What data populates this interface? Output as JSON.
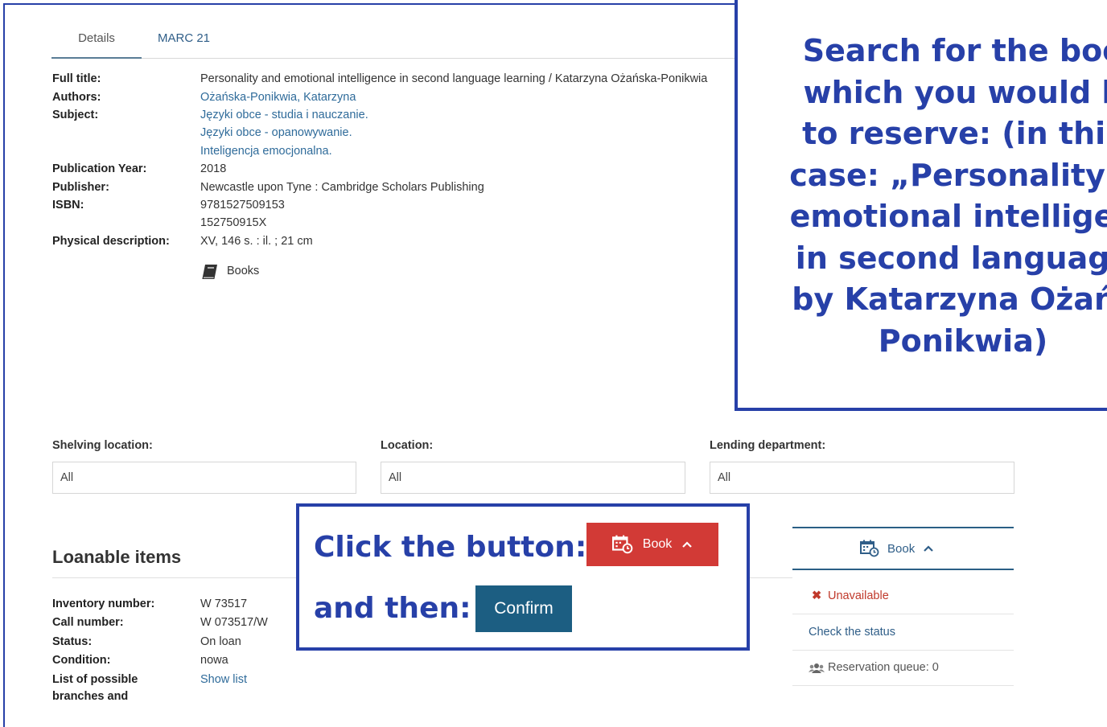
{
  "tabs": {
    "details": "Details",
    "marc": "MARC 21"
  },
  "record": {
    "full_title_label": "Full title:",
    "full_title": "Personality and emotional intelligence in second language learning / Katarzyna Ożańska-Ponikwia",
    "authors_label": "Authors:",
    "author": "Ożańska-Ponikwia, Katarzyna",
    "subject_label": "Subject:",
    "subjects": [
      "Języki obce - studia i nauczanie.",
      "Języki obce - opanowywanie.",
      "Inteligencja emocjonalna."
    ],
    "year_label": "Publication Year:",
    "year": "2018",
    "publisher_label": "Publisher:",
    "publisher": "Newcastle upon Tyne : Cambridge Scholars Publishing",
    "isbn_label": "ISBN:",
    "isbn": [
      "9781527509153",
      "152750915X"
    ],
    "physical_label": "Physical description:",
    "physical": "XV, 146 s. : il. ; 21 cm",
    "format": "Books",
    "format_icon": "book-icon"
  },
  "filters": {
    "shelving_label": "Shelving location:",
    "shelving_value": "All",
    "location_label": "Location:",
    "location_value": "All",
    "lending_label": "Lending department:",
    "lending_value": "All"
  },
  "loanable": {
    "title": "Loanable items",
    "inventory_label": "Inventory number:",
    "inventory": "W 73517",
    "call_label": "Call number:",
    "call": "W 073517/W",
    "status_label": "Status:",
    "status": "On loan",
    "condition_label": "Condition:",
    "condition": "nowa",
    "branches_label_1": "List of possible",
    "branches_label_2": "branches and",
    "branches_link": "Show list"
  },
  "side": {
    "book_label": "Book",
    "unavailable": "Unavailable",
    "check_status": "Check the status",
    "queue": "Reservation queue: 0",
    "unavailable_color": "#c0392b"
  },
  "callouts": {
    "search_lines": [
      "Search for the boo",
      "which you would li",
      "to reserve: (in this",
      "case: „Personality a",
      "emotional intelligen",
      "in second language",
      "by Katarzyna Ożańs",
      "Ponikwia)"
    ],
    "click_text": "Click the button:",
    "book_button": "Book",
    "then_text": "and then:",
    "confirm_button": "Confirm",
    "accent_color": "#2740a8",
    "red_button_color": "#d23a36",
    "confirm_color": "#1c5e82"
  }
}
